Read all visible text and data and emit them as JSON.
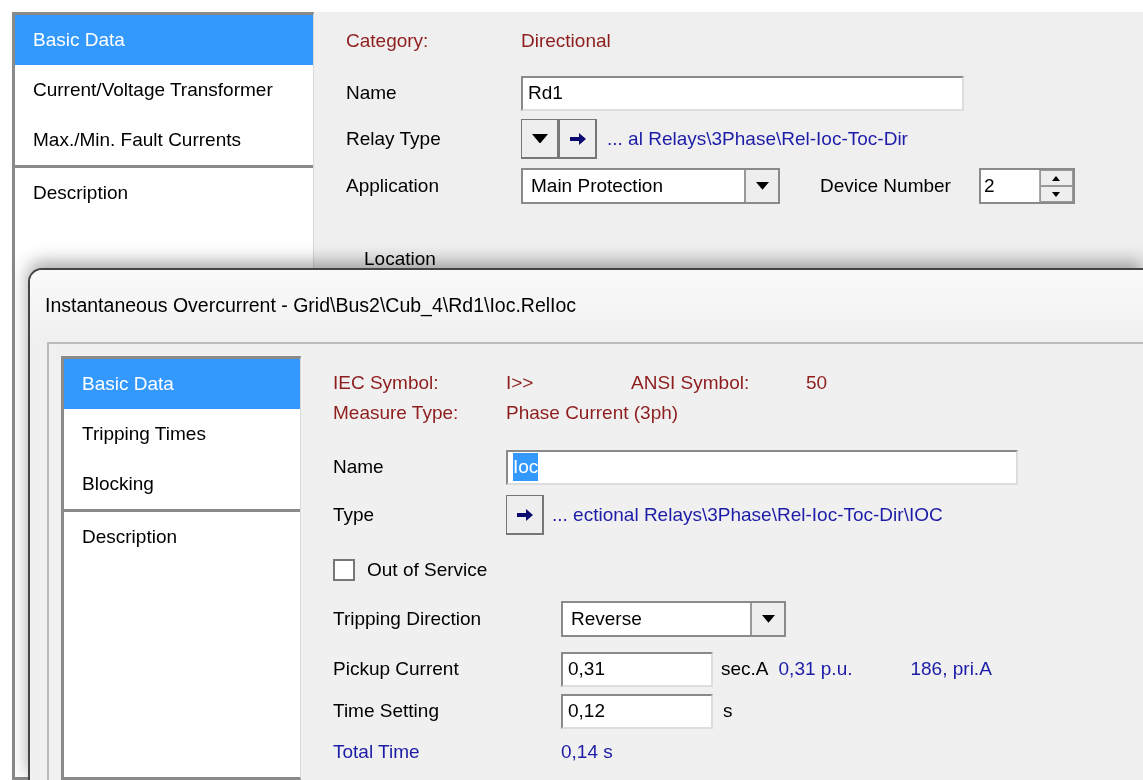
{
  "main_window": {
    "tabs": [
      {
        "label": "Basic Data",
        "selected": true
      },
      {
        "label": "Current/Voltage Transformer",
        "selected": false
      },
      {
        "label": "Max./Min. Fault Currents",
        "selected": false
      }
    ],
    "extra_tabs": [
      {
        "label": "Description",
        "selected": false
      }
    ],
    "category": {
      "label": "Category:",
      "value": "Directional"
    },
    "name": {
      "label": "Name",
      "value": "Rd1"
    },
    "relay_type": {
      "label": "Relay Type",
      "path": "... al Relays\\3Phase\\Rel-Ioc-Toc-Dir"
    },
    "application": {
      "label": "Application",
      "value": "Main Protection"
    },
    "device_number": {
      "label": "Device Number",
      "value": "2"
    },
    "location": {
      "label": "Location"
    }
  },
  "dialog": {
    "title": "Instantaneous Overcurrent - Grid\\Bus2\\Cub_4\\Rd1\\Ioc.RelIoc",
    "tabs": [
      {
        "label": "Basic Data",
        "selected": true
      },
      {
        "label": "Tripping Times",
        "selected": false
      },
      {
        "label": "Blocking",
        "selected": false
      }
    ],
    "extra_tabs": [
      {
        "label": "Description",
        "selected": false
      }
    ],
    "iec_symbol": {
      "label": "IEC Symbol:",
      "value": "I>>"
    },
    "ansi_symbol": {
      "label": "ANSI Symbol:",
      "value": "50"
    },
    "measure_type": {
      "label": "Measure Type:",
      "value": "Phase Current (3ph)"
    },
    "name": {
      "label": "Name",
      "value": "Ioc",
      "text_selected": true
    },
    "type": {
      "label": "Type",
      "path": "... ectional Relays\\3Phase\\Rel-Ioc-Toc-Dir\\IOC"
    },
    "out_of_service": {
      "label": "Out of Service",
      "checked": false
    },
    "tripping_direction": {
      "label": "Tripping Direction",
      "value": "Reverse"
    },
    "pickup_current": {
      "label": "Pickup Current",
      "value": "0,31",
      "unit": "sec.A",
      "pu": "0,31 p.u.",
      "primary": "186, pri.A"
    },
    "time_setting": {
      "label": "Time Setting",
      "value": "0,12",
      "unit": "s"
    },
    "total_time": {
      "label": "Total Time",
      "value": "0,14 s"
    }
  }
}
